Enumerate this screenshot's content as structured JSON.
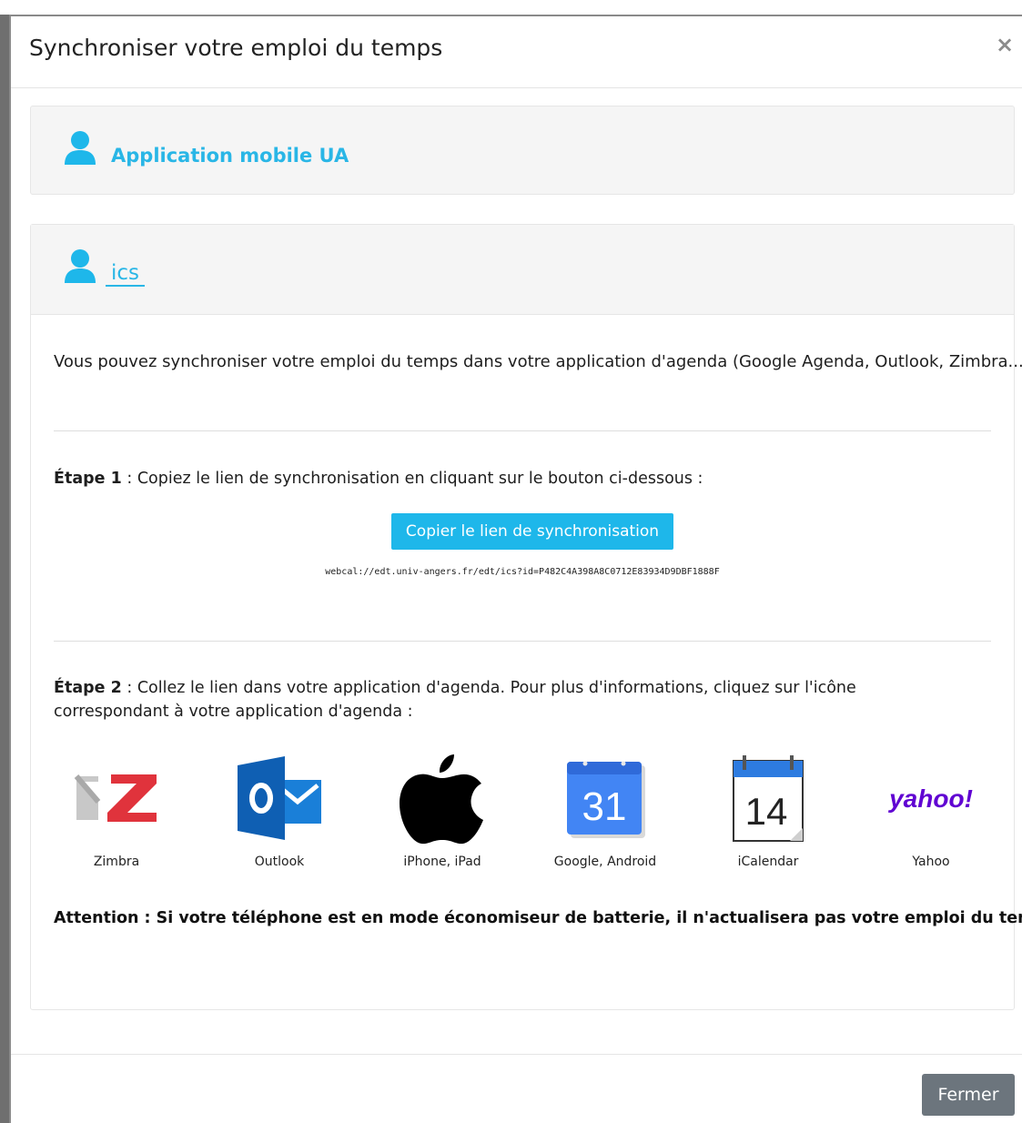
{
  "modal": {
    "title": "Synchroniser votre emploi du temps",
    "close_symbol": "×"
  },
  "panels": [
    {
      "label": "Application mobile UA",
      "icon": "user-icon"
    },
    {
      "label": "ics",
      "icon": "user-icon"
    }
  ],
  "ics": {
    "intro": "Vous pouvez synchroniser votre emploi du temps dans votre application d'agenda (Google Agenda, Outlook, Zimbra...)",
    "step1_label": "Étape 1",
    "step1_text": " : Copiez le lien de synchronisation en cliquant sur le bouton ci-dessous :",
    "copy_button": "Copier le lien de synchronisation",
    "url": "webcal://edt.univ-angers.fr/edt/ics?id=P482C4A398A8C0712E83934D9DBF1888F",
    "step2_label": "Étape 2",
    "step2_text": " : Collez le lien dans votre application d'agenda. Pour plus d'informations, cliquez sur l'icône correspondant à votre application d'agenda :",
    "apps": [
      {
        "label": "Zimbra",
        "icon": "zimbra-icon"
      },
      {
        "label": "Outlook",
        "icon": "outlook-icon"
      },
      {
        "label": "iPhone, iPad",
        "icon": "apple-icon"
      },
      {
        "label": "Google, Android",
        "icon": "google-calendar-icon",
        "logo_text": "31"
      },
      {
        "label": "iCalendar",
        "icon": "icalendar-icon",
        "logo_text": "14"
      },
      {
        "label": "Yahoo",
        "icon": "yahoo-icon",
        "logo_text": "yahoo!"
      }
    ],
    "warning": "Attention : Si votre téléphone est en mode économiseur de batterie, il n'actualisera pas votre emploi du temps."
  },
  "footer": {
    "close_button": "Fermer"
  },
  "colors": {
    "accent": "#1eb7ea",
    "secondary_button": "#6c757d",
    "yahoo": "#6001d2",
    "zimbra_red": "#e0333c",
    "outlook_blue": "#0f6cbd",
    "google_blue": "#4285f4"
  }
}
